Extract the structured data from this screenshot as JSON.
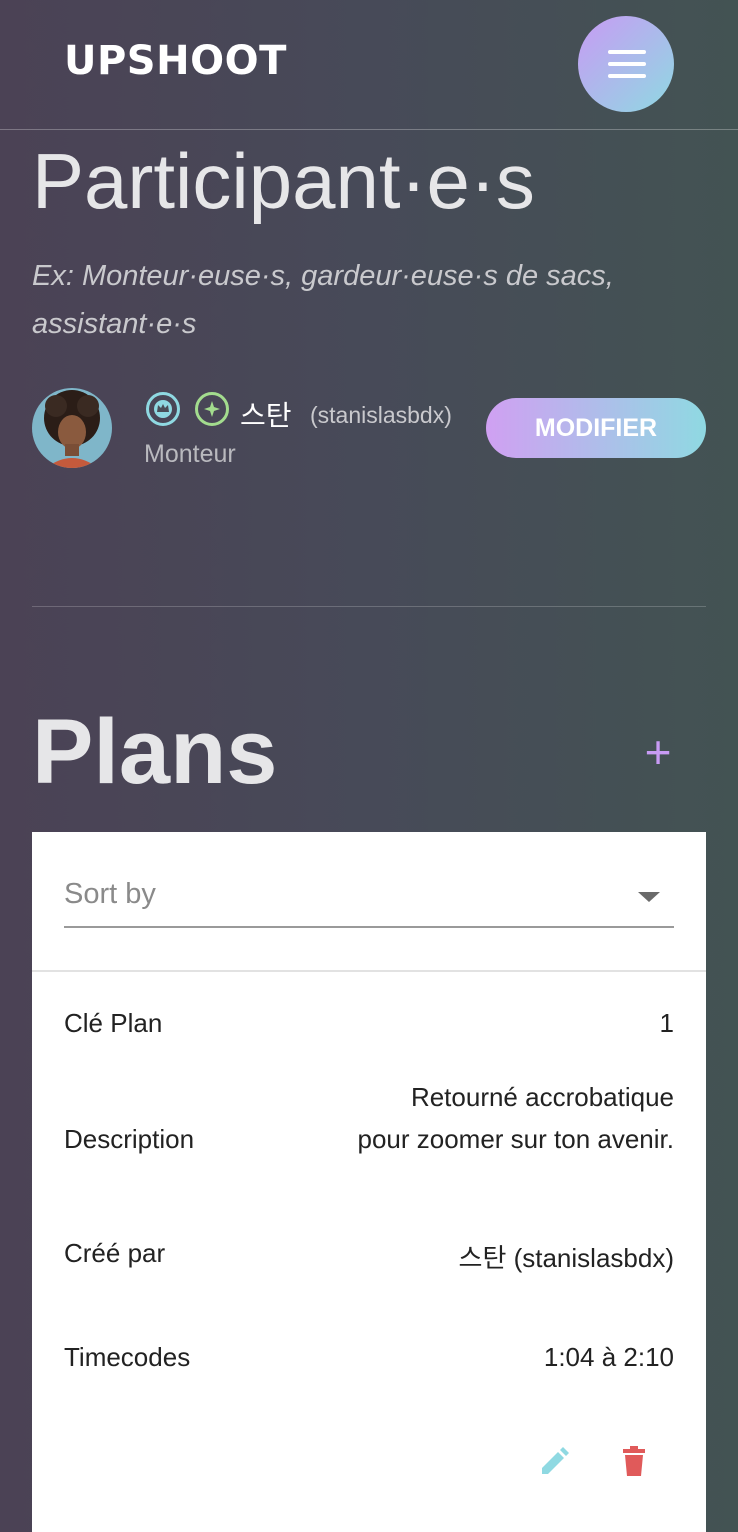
{
  "header": {
    "logo": "UPSHOOT",
    "menu_icon": "hamburger-menu-icon"
  },
  "participants": {
    "title": "Participant·e·s",
    "subtitle": "Ex: Monteur·euse·s, gardeur·euse·s de sacs, assistant·e·s",
    "member": {
      "name": "스탄",
      "handle": "(stanislasbdx)",
      "role": "Monteur",
      "badges": [
        "crown-icon",
        "sparkle-icon"
      ],
      "edit_label": "MODIFIER"
    }
  },
  "plans": {
    "title": "Plans",
    "add_label": "+",
    "sort": {
      "placeholder": "Sort by"
    },
    "rows": [
      {
        "label": "Clé Plan",
        "value": "1"
      },
      {
        "label": "Description",
        "value": "Retourné accrobatique pour zoomer sur ton avenir."
      },
      {
        "label": "Créé par",
        "value": "스탄 (stanislasbdx)"
      },
      {
        "label": "Timecodes",
        "value": "1:04 à 2:10"
      }
    ],
    "actions": {
      "edit_icon": "pencil-icon",
      "delete_icon": "trash-icon"
    }
  },
  "colors": {
    "accent_purple": "#c89bf4",
    "accent_cyan": "#8fd9e2",
    "accent_green": "#a3dc8e",
    "delete_red": "#e05a5a"
  }
}
